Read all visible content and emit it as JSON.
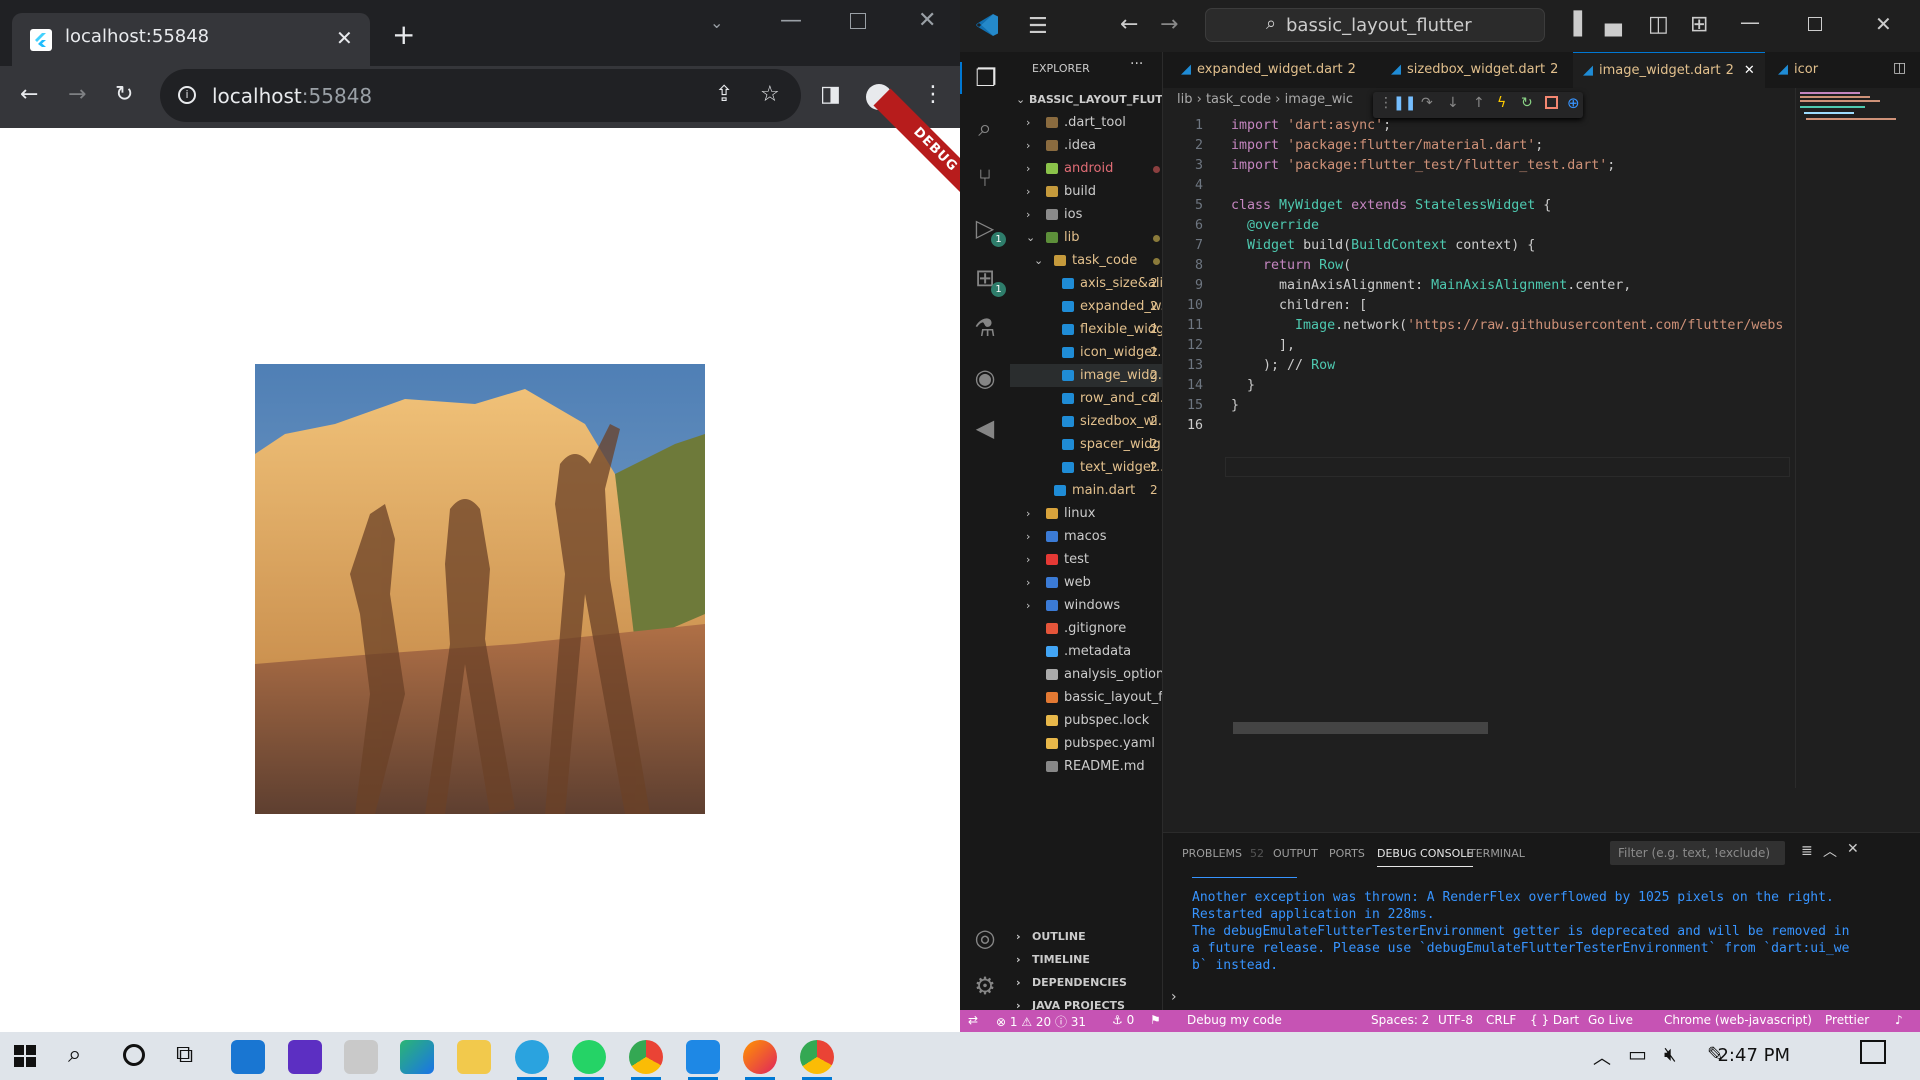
{
  "chrome": {
    "tab_title": "localhost:55848",
    "new_tab": "+",
    "url_host": "localhost",
    "url_port": ":55848",
    "debug_banner": "DEBUG",
    "image_alt": "photo"
  },
  "vscode": {
    "command_center": "bassic_layout_flutter",
    "explorer": {
      "title": "EXPLORER",
      "root": "BASSIC_LAYOUT_FLUTTER",
      "items": [
        {
          "name": ".dart_tool",
          "color": "#cccccc"
        },
        {
          "name": ".idea",
          "color": "#cccccc"
        },
        {
          "name": "android",
          "color": "#e06c75",
          "badge": "dot"
        },
        {
          "name": "build",
          "color": "#cccccc"
        },
        {
          "name": "ios",
          "color": "#cccccc"
        },
        {
          "name": "lib",
          "color": "#e2c08d",
          "badge": "dot"
        },
        {
          "name": "task_code",
          "color": "#e2c08d",
          "badge": "dot"
        },
        {
          "name": "axis_size&ali...",
          "color": "#e2c08d",
          "count": "2"
        },
        {
          "name": "expanded_w...",
          "color": "#e2c08d",
          "count": "2"
        },
        {
          "name": "flexible_widg...",
          "color": "#e2c08d",
          "count": "2"
        },
        {
          "name": "icon_widget....",
          "color": "#e2c08d",
          "count": "2"
        },
        {
          "name": "image_widg...",
          "color": "#e2c08d",
          "count": "2"
        },
        {
          "name": "row_and_col...",
          "color": "#e2c08d",
          "count": "2"
        },
        {
          "name": "sizedbox_wi...",
          "color": "#e2c08d",
          "count": "2"
        },
        {
          "name": "spacer_widg...",
          "color": "#e2c08d",
          "count": "2"
        },
        {
          "name": "text_widget....",
          "color": "#e2c08d",
          "count": "2"
        },
        {
          "name": "main.dart",
          "color": "#e2c08d",
          "count": "2"
        },
        {
          "name": "linux",
          "color": "#cccccc"
        },
        {
          "name": "macos",
          "color": "#cccccc"
        },
        {
          "name": "test",
          "color": "#cccccc"
        },
        {
          "name": "web",
          "color": "#cccccc"
        },
        {
          "name": "windows",
          "color": "#cccccc"
        },
        {
          "name": ".gitignore",
          "color": "#cccccc"
        },
        {
          "name": ".metadata",
          "color": "#cccccc"
        },
        {
          "name": "analysis_options.yaml",
          "color": "#cccccc"
        },
        {
          "name": "bassic_layout_flutter...",
          "color": "#cccccc"
        },
        {
          "name": "pubspec.lock",
          "color": "#cccccc"
        },
        {
          "name": "pubspec.yaml",
          "color": "#cccccc"
        },
        {
          "name": "README.md",
          "color": "#cccccc"
        }
      ],
      "sections": [
        "OUTLINE",
        "TIMELINE",
        "DEPENDENCIES",
        "JAVA PROJECTS"
      ]
    },
    "tabs": [
      {
        "name": "expanded_widget.dart",
        "count": "2"
      },
      {
        "name": "sizedbox_widget.dart",
        "count": "2"
      },
      {
        "name": "image_widget.dart",
        "count": "2",
        "active": true
      },
      {
        "name": "icor",
        "count": ""
      }
    ],
    "breadcrumb": [
      "lib",
      "task_code",
      "image_wic"
    ],
    "code_lines": [
      {
        "n": "1",
        "t": "import 'dart:async';"
      },
      {
        "n": "2",
        "t": "import 'package:flutter/material.dart';"
      },
      {
        "n": "3",
        "t": "import 'package:flutter_test/flutter_test.dart';"
      },
      {
        "n": "4",
        "t": ""
      },
      {
        "n": "5",
        "t": "class MyWidget extends StatelessWidget {"
      },
      {
        "n": "6",
        "t": "  @override"
      },
      {
        "n": "7",
        "t": "  Widget build(BuildContext context) {"
      },
      {
        "n": "8",
        "t": "    return Row("
      },
      {
        "n": "9",
        "t": "      mainAxisAlignment: MainAxisAlignment.center,"
      },
      {
        "n": "10",
        "t": "      children: ["
      },
      {
        "n": "11",
        "t": "        Image.network('https://raw.githubusercontent.com/flutter/webs"
      },
      {
        "n": "12",
        "t": "      ],"
      },
      {
        "n": "13",
        "t": "    ); // Row"
      },
      {
        "n": "14",
        "t": "  }"
      },
      {
        "n": "15",
        "t": "}"
      },
      {
        "n": "16",
        "t": ""
      }
    ],
    "panel": {
      "tabs": [
        "PROBLEMS",
        "OUTPUT",
        "PORTS",
        "DEBUG CONSOLE",
        "TERMINAL"
      ],
      "problems_count": "52",
      "filter_placeholder": "Filter (e.g. text, !exclude)",
      "console": [
        "Another exception was thrown: A RenderFlex overflowed by 1025 pixels on the right.",
        "Restarted application in 228ms.",
        "The debugEmulateFlutterTesterEnvironment getter is deprecated and will be removed in",
        "a future release. Please use `debugEmulateFlutterTesterEnvironment` from `dart:ui_we",
        "b` instead."
      ]
    },
    "status": {
      "errors": "⊗ 1 ⚠ 20 ⓘ 31",
      "ports": "⚓ 0",
      "debug": "Debug my code",
      "spaces": "Spaces: 2",
      "encoding": "UTF-8",
      "eol": "CRLF",
      "lang": "{ } Dart",
      "golive": "Go Live",
      "device": "Chrome (web-javascript)",
      "prettier": "Prettier"
    }
  },
  "taskbar": {
    "time": "2:47 PM"
  }
}
